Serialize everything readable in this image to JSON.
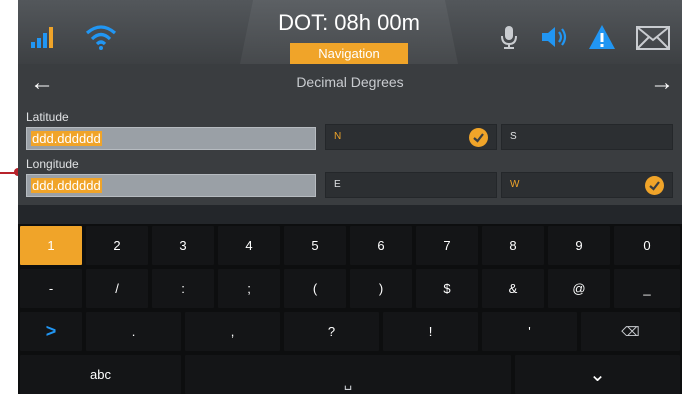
{
  "status": {
    "dot_title": "DOT: 08h 00m",
    "nav_tab": "Navigation"
  },
  "title_row": {
    "title": "Decimal Degrees",
    "back_glyph": "←",
    "forward_glyph": "→"
  },
  "fields": {
    "latitude_label": "Latitude",
    "latitude_value": "ddd.dddddd",
    "longitude_label": "Longitude",
    "longitude_value": "ddd.dddddd"
  },
  "options": {
    "n": "N",
    "s": "S",
    "e": "E",
    "w": "W"
  },
  "keyboard": {
    "row1": [
      "1",
      "2",
      "3",
      "4",
      "5",
      "6",
      "7",
      "8",
      "9",
      "0"
    ],
    "row2": [
      "-",
      "/",
      ":",
      ";",
      "(",
      ")",
      "$",
      "&",
      "@",
      "_"
    ],
    "row3": [
      ">",
      ".",
      ",",
      "?",
      "!",
      "'",
      "⌫"
    ],
    "row4_left": "abc",
    "space_glyph": "␣",
    "collapse_glyph": "⌄"
  },
  "colors": {
    "accent": "#f0a429",
    "blue": "#2196f3",
    "background": "#3a3d40"
  },
  "icons": [
    "signal-icon",
    "wifi-icon",
    "microphone-icon",
    "speaker-icon",
    "warning-icon",
    "mail-icon"
  ]
}
